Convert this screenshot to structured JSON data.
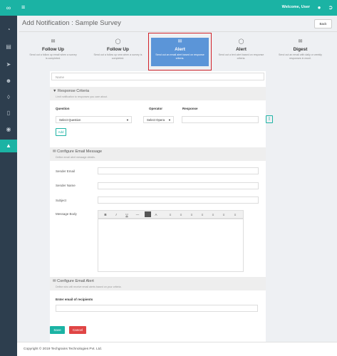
{
  "topbar": {
    "menu_icon": "hamburger-icon",
    "welcome": "Welcome, User",
    "user_icon": "user-icon",
    "logout_icon": "logout-icon"
  },
  "sidebar": {
    "logo_icon": "infinity-icon",
    "items": [
      {
        "icon": "dashboard-icon"
      },
      {
        "icon": "book-icon"
      },
      {
        "icon": "send-icon"
      },
      {
        "icon": "user-icon"
      },
      {
        "icon": "layers-icon"
      },
      {
        "icon": "mobile-icon"
      },
      {
        "icon": "lifebuoy-icon"
      },
      {
        "icon": "alert-icon",
        "active": true
      }
    ]
  },
  "header": {
    "title": "Add Notification : Sample Survey",
    "back_label": "Back"
  },
  "types": [
    {
      "icon": "envelope-icon",
      "title": "Follow Up",
      "desc": "Send out a follow up email when a survey is completed."
    },
    {
      "icon": "speech-bubble-icon",
      "title": "Follow Up",
      "desc": "Send out a follow up sms when a survey is completed."
    },
    {
      "icon": "envelope-icon",
      "title": "Alert",
      "desc": "Send out an email alert based on response criteria.",
      "active": true
    },
    {
      "icon": "speech-bubble-icon",
      "title": "Alert",
      "desc": "Send out a text alert based on response criteria."
    },
    {
      "icon": "envelope-icon",
      "title": "Digest",
      "desc": "Send out an email with daily or weekly responses in excel."
    }
  ],
  "form": {
    "name_placeholder": "Name",
    "response_criteria": {
      "title": "Response Criteria",
      "subtitle": "Limit notification to responses you care about.",
      "col_question": "Question",
      "col_operator": "Operator",
      "col_response": "Response",
      "question_value": "Select Question",
      "operator_value": "Select Opera",
      "add_label": "Add"
    },
    "email_message": {
      "title": "Configure Email Message",
      "subtitle": "Define email alert message details.",
      "sender_email": "Sender Email",
      "sender_name": "Sender Name",
      "subject": "Subject",
      "message_body": "Message Body",
      "toolbar": [
        "B",
        "I",
        "U",
        "—",
        "A",
        "≡",
        "≡",
        "≡",
        "≡",
        "≡",
        "≡",
        "≡"
      ]
    },
    "email_alert": {
      "title": "Configure Email Alert",
      "subtitle": "Define who will receive email alerts based on your criteria.",
      "recipients_label": "Enter email of recipients"
    },
    "save_label": "Save",
    "cancel_label": "Cancel"
  },
  "footer": {
    "copyright": "Copyright © 2019 Techgrains Technologies Pvt. Ltd."
  },
  "colors": {
    "brand": "#1bb3a4",
    "sidebar": "#2d3e4e",
    "active_card": "#5b95d8",
    "cancel": "#e04545",
    "highlight_frame": "#d2232a"
  }
}
